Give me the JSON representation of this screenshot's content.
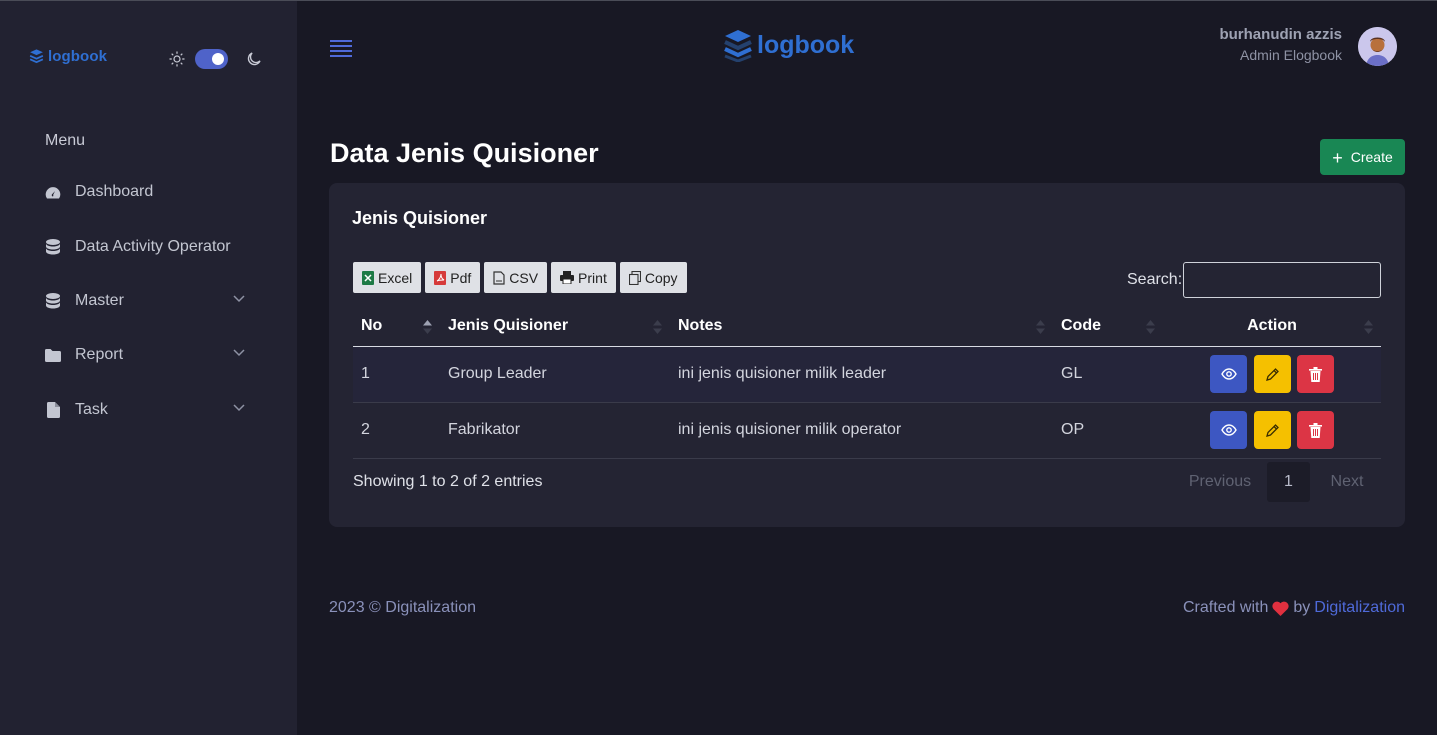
{
  "brand": {
    "name": "logbook",
    "color": "#2f6fd2"
  },
  "sidebar": {
    "theme": {
      "light_icon": "sun-icon",
      "dark_icon": "moon-icon",
      "dark_mode": true
    },
    "menu_title": "Menu",
    "items": [
      {
        "label": "Dashboard",
        "icon": "gauge-icon"
      },
      {
        "label": "Data Activity Operator",
        "icon": "database-icon"
      },
      {
        "label": "Master",
        "icon": "database-icon",
        "has_children": true
      },
      {
        "label": "Report",
        "icon": "folder-icon",
        "has_children": true
      },
      {
        "label": "Task",
        "icon": "file-icon",
        "has_children": true
      }
    ]
  },
  "header": {
    "user_name": "burhanudin azzis",
    "user_role": "Admin Elogbook"
  },
  "page": {
    "title": "Data Jenis Quisioner",
    "create_label": "Create"
  },
  "card": {
    "title": "Jenis Quisioner",
    "export_buttons": [
      "Excel",
      "Pdf",
      "CSV",
      "Print",
      "Copy"
    ],
    "search_label": "Search:",
    "search_value": "",
    "columns": [
      "No",
      "Jenis Quisioner",
      "Notes",
      "Code",
      "Action"
    ],
    "rows": [
      {
        "no": "1",
        "jenis": "Group Leader",
        "notes": "ini jenis quisioner milik leader",
        "code": "GL"
      },
      {
        "no": "2",
        "jenis": "Fabrikator",
        "notes": "ini jenis quisioner milik operator",
        "code": "OP"
      }
    ],
    "info": "Showing 1 to 2 of 2 entries",
    "pagination": {
      "previous": "Previous",
      "current": "1",
      "next": "Next"
    }
  },
  "footer": {
    "left": "2023 © Digitalization",
    "crafted": "Crafted with",
    "by": "by",
    "link": "Digitalization"
  }
}
